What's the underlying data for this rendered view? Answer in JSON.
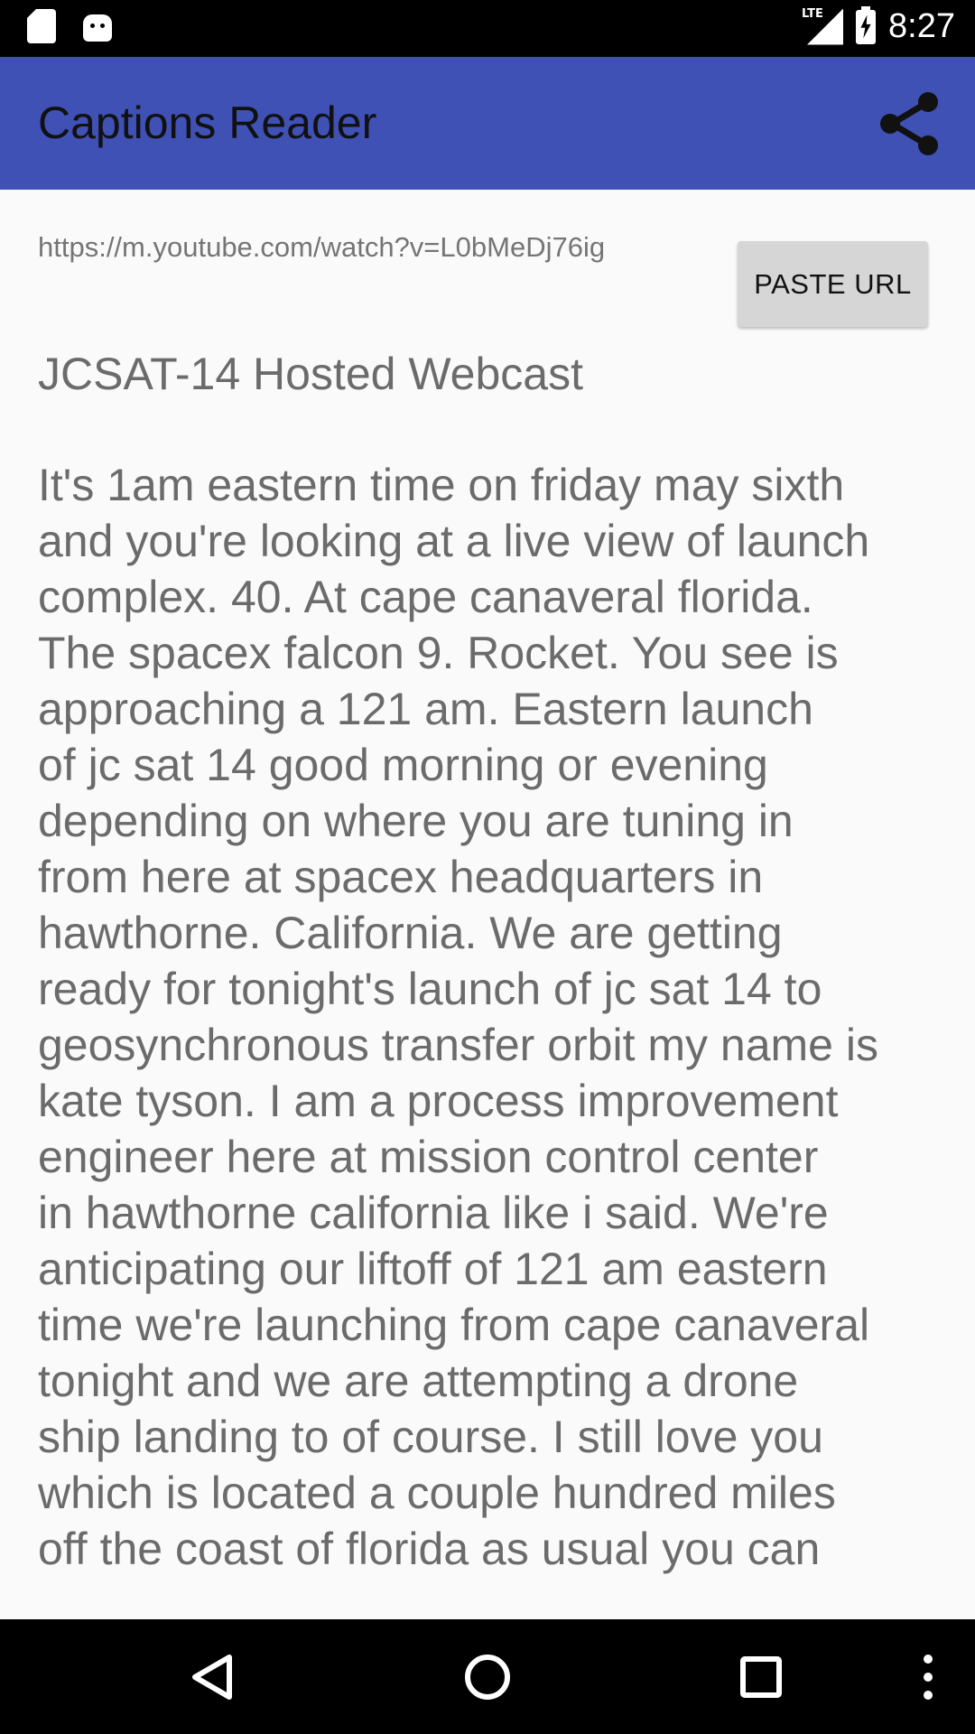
{
  "status_bar": {
    "time": "8:27",
    "network_label": "LTE",
    "left_icons": [
      "sd-card-icon",
      "android-icon"
    ],
    "right_icons": [
      "signal-icon",
      "battery-charging-icon"
    ]
  },
  "app_bar": {
    "title": "Captions Reader",
    "background_color": "#3f51b5",
    "action_icon": "share-icon"
  },
  "main": {
    "url_value": "https://m.youtube.com/watch?v=L0bMeDj76ig",
    "paste_button_label": "PASTE URL",
    "video_title": "JCSAT-14 Hosted Webcast",
    "captions_text": "It's 1am eastern time on friday may sixth\nand you're looking at a live view of launch\ncomplex. 40. At cape canaveral florida.\nThe spacex falcon 9. Rocket. You see is\napproaching a 121 am. Eastern launch\nof jc sat 14 good morning or evening\ndepending on where you are tuning in\nfrom here at spacex headquarters in\nhawthorne. California. We are getting\nready for tonight's launch of jc sat 14 to\ngeosynchronous transfer orbit my name is\nkate tyson. I am a process improvement\nengineer here at mission control center\nin hawthorne california like i said. We're\nanticipating our liftoff of 121 am eastern\ntime we're launching from cape canaveral\ntonight and we are attempting a drone\nship landing to of course. I still love you\nwhich is located a couple hundred miles\noff the coast of florida as usual you can"
  },
  "nav_bar": {
    "buttons": [
      "back-icon",
      "home-icon",
      "recents-icon",
      "overflow-menu-icon"
    ]
  }
}
